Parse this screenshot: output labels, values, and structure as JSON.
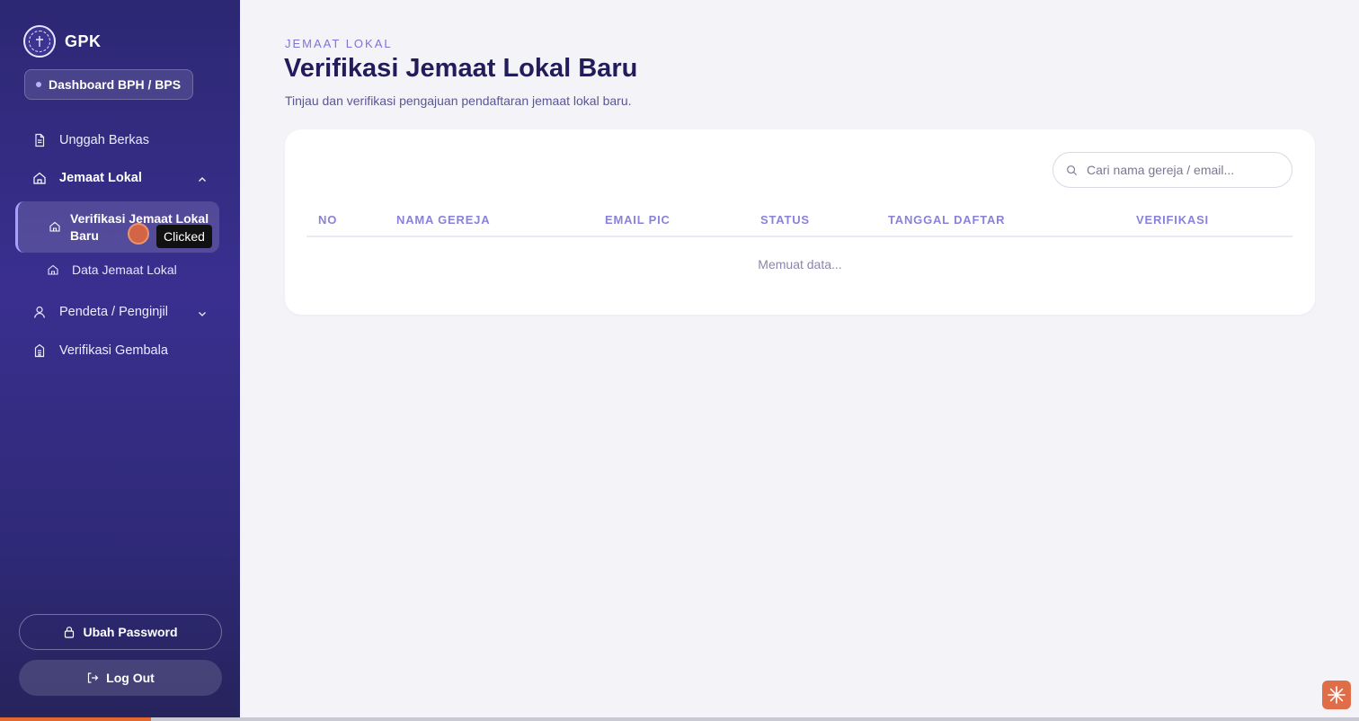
{
  "sidebar": {
    "brand": "GPK",
    "role": "Dashboard BPH / BPS",
    "items": [
      {
        "label": "Unggah Berkas",
        "icon": "document-icon"
      },
      {
        "label": "Jemaat Lokal",
        "icon": "home-icon",
        "expanded": true
      },
      {
        "label": "Pendeta / Penginjil",
        "icon": "person-icon"
      },
      {
        "label": "Verifikasi Gembala",
        "icon": "building-icon"
      }
    ],
    "subitems": [
      {
        "label": "Verifikasi Jemaat Lokal Baru",
        "icon": "home-icon",
        "active": true
      },
      {
        "label": "Data Jemaat Lokal",
        "icon": "home-icon"
      }
    ],
    "change_password": "Ubah Password",
    "logout": "Log Out"
  },
  "overlay": {
    "tooltip": "Clicked"
  },
  "main": {
    "eyebrow": "JEMAAT LOKAL",
    "title": "Verifikasi Jemaat Lokal Baru",
    "subtitle": "Tinjau dan verifikasi pengajuan pendaftaran jemaat lokal baru.",
    "search_placeholder": "Cari nama gereja / email...",
    "columns": [
      "NO",
      "NAMA GEREJA",
      "EMAIL PIC",
      "STATUS",
      "TANGGAL DAFTAR",
      "VERIFIKASI"
    ],
    "loading_text": "Memuat data..."
  },
  "colors": {
    "sidebar": "#2f2a78",
    "accent": "#8a82d8",
    "title": "#221c5a",
    "click_marker": "#e76a37"
  }
}
